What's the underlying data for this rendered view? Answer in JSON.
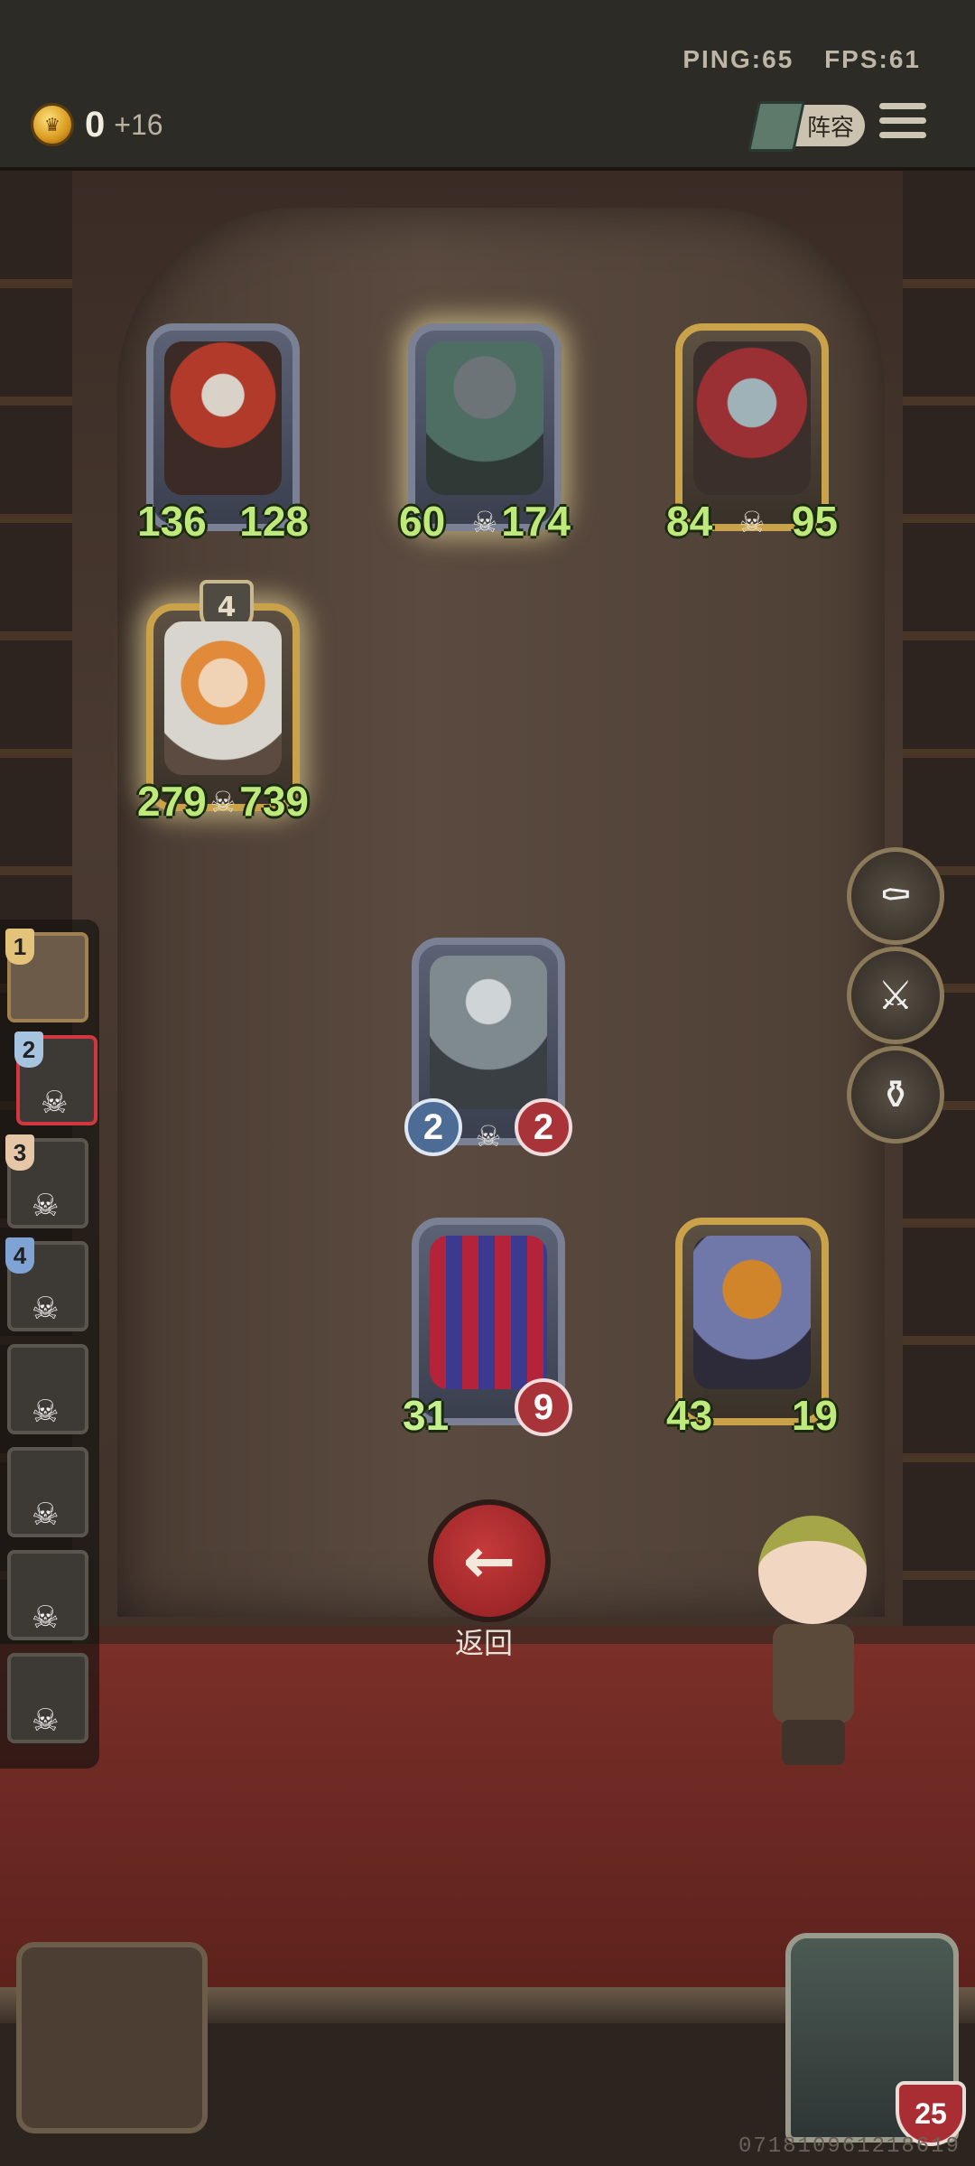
{
  "status": {
    "ping": "PING:65",
    "fps": "FPS:61"
  },
  "currency": {
    "value": "0",
    "income": "+16"
  },
  "toolbar": {
    "lineup_label": "阵容"
  },
  "board": {
    "enemies": [
      {
        "atk": "136",
        "hp": "128"
      },
      {
        "atk": "60",
        "hp": "174"
      },
      {
        "atk": "84",
        "hp": "95"
      },
      {
        "atk": "279",
        "hp": "739",
        "level": "4"
      }
    ],
    "allies": [
      {
        "atk": "2",
        "hp": "2"
      },
      {
        "atk": "31",
        "hp": "9"
      },
      {
        "atk": "43",
        "hp": "19"
      }
    ]
  },
  "queue": {
    "numbers": [
      "1",
      "2",
      "3",
      "4"
    ]
  },
  "actions": {
    "back_label": "返回"
  },
  "player": {
    "hp": "25"
  },
  "seed": "07181096121861​9"
}
